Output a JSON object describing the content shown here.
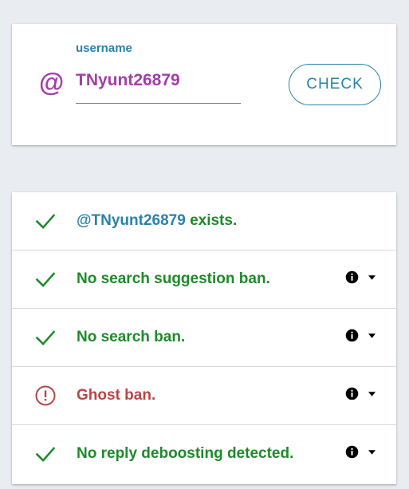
{
  "search": {
    "label": "username",
    "value": "TNyunt26879",
    "at_symbol": "@",
    "button_label": "CHECK"
  },
  "results": {
    "exists": {
      "handle": "@TNyunt26879",
      "suffix": " exists.",
      "status": "ok"
    },
    "items": [
      {
        "text": "No search suggestion ban.",
        "status": "ok"
      },
      {
        "text": "No search ban.",
        "status": "ok"
      },
      {
        "text": "Ghost ban.",
        "status": "error"
      },
      {
        "text": "No reply deboosting detected.",
        "status": "ok"
      }
    ]
  },
  "colors": {
    "background": "#e9edf1",
    "accent_blue": "#2a81ad",
    "accent_purple": "#a33da8",
    "ok_green": "#1e8a2a",
    "error_red": "#b84545"
  },
  "icons": {
    "at": "at-icon",
    "ok": "checkmark-icon",
    "error": "alert-circle-icon",
    "info": "info-icon",
    "expand": "caret-down-icon"
  }
}
